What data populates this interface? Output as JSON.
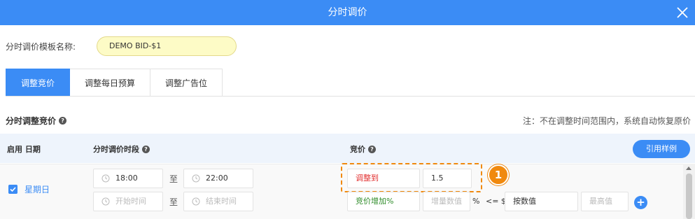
{
  "dialog": {
    "title": "分时调价",
    "close_icon": "close-icon"
  },
  "template": {
    "label": "分时调价模板名称:",
    "value": "DEMO BID-$1"
  },
  "tabs": [
    {
      "label": "调整竞价",
      "active": true
    },
    {
      "label": "调整每日预算",
      "active": false
    },
    {
      "label": "调整广告位",
      "active": false
    }
  ],
  "section": {
    "title": "分时调整竞价",
    "note": "注：不在调整时间范围内，系统自动恢复原价"
  },
  "table": {
    "col_enable_date": "启用 日期",
    "col_time": "分时调价时段",
    "col_bid": "竞价",
    "ref_button": "引用样例"
  },
  "row": {
    "enabled": true,
    "day": "星期日",
    "slot1": {
      "start": "18:00",
      "sep": "至",
      "end": "22:00",
      "mode": "调整到",
      "value": "1.5"
    },
    "slot2": {
      "start_placeholder": "开始时间",
      "sep": "至",
      "end_placeholder": "结束时间",
      "mode": "竞价增加%",
      "increase_placeholder": "增量数值",
      "percent": "%",
      "le_symbol": "<= $",
      "by_value": "按数值",
      "max_placeholder": "最高值"
    }
  },
  "annotation": {
    "badge": "1"
  },
  "colors": {
    "primary": "#3b8cf5",
    "annotation": "#f0890e",
    "highlight_pill": "#fdfbc6"
  }
}
